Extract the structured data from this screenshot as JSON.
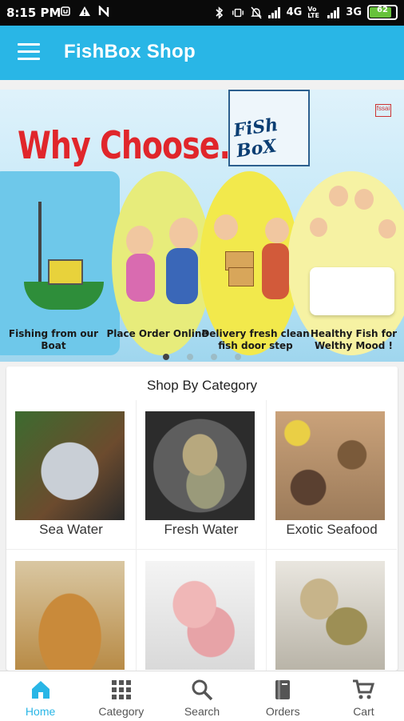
{
  "status_bar": {
    "time": "8:15 PM",
    "network1": "4G",
    "network1_sub": "Vo LTE",
    "network2": "3G",
    "battery": "62"
  },
  "app_bar": {
    "title": "FishBox Shop",
    "menu_icon": "hamburger-menu-icon"
  },
  "banner": {
    "headline": "Why Choose...?",
    "logo_text": "FiSh BoX",
    "corner_tag": "fssai",
    "steps": [
      {
        "caption": "Fishing from our Boat"
      },
      {
        "caption": "Place Order Online"
      },
      {
        "caption": "Delivery fresh clean fish door step"
      },
      {
        "caption": "Healthy Fish for Welthy Mood !"
      }
    ],
    "carousel_dots": 4,
    "active_dot": 0
  },
  "categories": {
    "heading": "Shop By Category",
    "items": [
      {
        "label": "Sea Water"
      },
      {
        "label": "Fresh Water"
      },
      {
        "label": "Exotic Seafood"
      },
      {
        "label": ""
      },
      {
        "label": ""
      },
      {
        "label": ""
      }
    ]
  },
  "bottom_nav": {
    "items": [
      {
        "label": "Home",
        "icon": "home-icon",
        "active": true
      },
      {
        "label": "Category",
        "icon": "grid-icon",
        "active": false
      },
      {
        "label": "Search",
        "icon": "search-icon",
        "active": false
      },
      {
        "label": "Orders",
        "icon": "book-icon",
        "active": false
      },
      {
        "label": "Cart",
        "icon": "cart-icon",
        "active": false
      }
    ]
  },
  "colors": {
    "primary": "#29b6e6",
    "headline_red": "#e0262b",
    "status_bar": "#0a0a0a"
  }
}
